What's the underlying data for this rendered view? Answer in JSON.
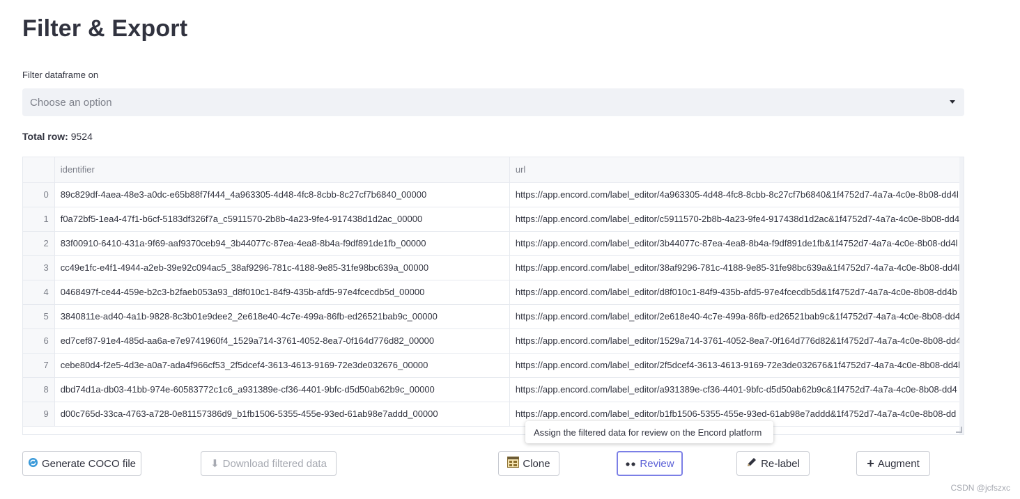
{
  "page": {
    "title": "Filter & Export"
  },
  "filter": {
    "label": "Filter dataframe on",
    "placeholder": "Choose an option"
  },
  "total": {
    "label": "Total row:",
    "value": "9524"
  },
  "table": {
    "columns": [
      "identifier",
      "url"
    ],
    "rows": [
      {
        "index": "0",
        "identifier": "89c829df-4aea-48e3-a0dc-e65b88f7f444_4a963305-4d48-4fc8-8cbb-8c27cf7b6840_00000",
        "url": "https://app.encord.com/label_editor/4a963305-4d48-4fc8-8cbb-8c27cf7b6840&1f4752d7-4a7a-4c0e-8b08-dd4l"
      },
      {
        "index": "1",
        "identifier": "f0a72bf5-1ea4-47f1-b6cf-5183df326f7a_c5911570-2b8b-4a23-9fe4-917438d1d2ac_00000",
        "url": "https://app.encord.com/label_editor/c5911570-2b8b-4a23-9fe4-917438d1d2ac&1f4752d7-4a7a-4c0e-8b08-dd4"
      },
      {
        "index": "2",
        "identifier": "83f00910-6410-431a-9f69-aaf9370ceb94_3b44077c-87ea-4ea8-8b4a-f9df891de1fb_00000",
        "url": "https://app.encord.com/label_editor/3b44077c-87ea-4ea8-8b4a-f9df891de1fb&1f4752d7-4a7a-4c0e-8b08-dd4l"
      },
      {
        "index": "3",
        "identifier": "cc49e1fc-e4f1-4944-a2eb-39e92c094ac5_38af9296-781c-4188-9e85-31fe98bc639a_00000",
        "url": "https://app.encord.com/label_editor/38af9296-781c-4188-9e85-31fe98bc639a&1f4752d7-4a7a-4c0e-8b08-dd4l"
      },
      {
        "index": "4",
        "identifier": "0468497f-ce44-459e-b2c3-b2faeb053a93_d8f010c1-84f9-435b-afd5-97e4fcecdb5d_00000",
        "url": "https://app.encord.com/label_editor/d8f010c1-84f9-435b-afd5-97e4fcecdb5d&1f4752d7-4a7a-4c0e-8b08-dd4b"
      },
      {
        "index": "5",
        "identifier": "3840811e-ad40-4a1b-9828-8c3b01e9dee2_2e618e40-4c7e-499a-86fb-ed26521bab9c_00000",
        "url": "https://app.encord.com/label_editor/2e618e40-4c7e-499a-86fb-ed26521bab9c&1f4752d7-4a7a-4c0e-8b08-dd4"
      },
      {
        "index": "6",
        "identifier": "ed7cef87-91e4-485d-aa6a-e7e9741960f4_1529a714-3761-4052-8ea7-0f164d776d82_00000",
        "url": "https://app.encord.com/label_editor/1529a714-3761-4052-8ea7-0f164d776d82&1f4752d7-4a7a-4c0e-8b08-dd4"
      },
      {
        "index": "7",
        "identifier": "cebe80d4-f2e5-4d3e-a0a7-ada4f966cf53_2f5dcef4-3613-4613-9169-72e3de032676_00000",
        "url": "https://app.encord.com/label_editor/2f5dcef4-3613-4613-9169-72e3de032676&1f4752d7-4a7a-4c0e-8b08-dd4l"
      },
      {
        "index": "8",
        "identifier": "dbd74d1a-db03-41bb-974e-60583772c1c6_a931389e-cf36-4401-9bfc-d5d50ab62b9c_00000",
        "url": "https://app.encord.com/label_editor/a931389e-cf36-4401-9bfc-d5d50ab62b9c&1f4752d7-4a7a-4c0e-8b08-dd4"
      },
      {
        "index": "9",
        "identifier": "d00c765d-33ca-4763-a728-0e81157386d9_b1fb1506-5355-455e-93ed-61ab98e7addd_00000",
        "url": "https://app.encord.com/label_editor/b1fb1506-5355-455e-93ed-61ab98e7addd&1f4752d7-4a7a-4c0e-8b08-dd"
      }
    ]
  },
  "tooltip": {
    "text": "Assign the filtered data for review on the Encord platform"
  },
  "buttons": {
    "generate_coco": "Generate COCO file",
    "download": "Download filtered data",
    "clone": "Clone",
    "review": "Review",
    "relabel": "Re-label",
    "augment": "Augment"
  },
  "icons": {
    "generate_coco": "refresh-icon",
    "download": "download-icon",
    "clone": "clone-icon",
    "review": "eyes-icon",
    "relabel": "pencil-icon",
    "augment": "plus-icon"
  },
  "colors": {
    "focus": "#7b7fe6",
    "select_bg": "#f0f2f6"
  },
  "watermark": "CSDN @jcfszxc"
}
